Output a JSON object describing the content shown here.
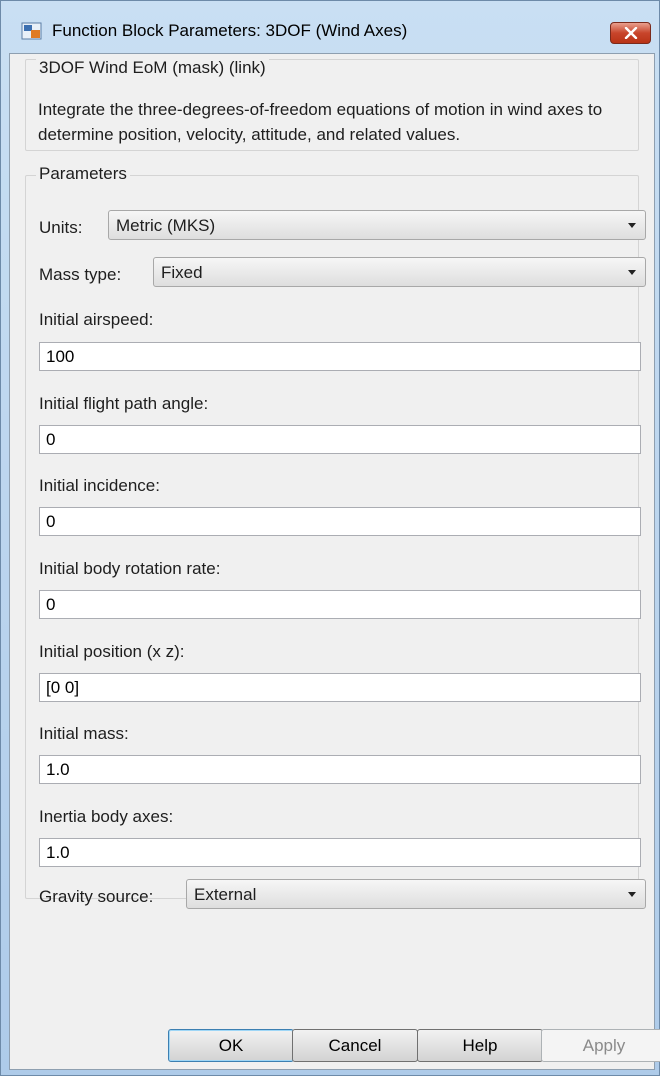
{
  "window": {
    "title": "Function Block Parameters: 3DOF (Wind Axes)"
  },
  "header": {
    "legend": "3DOF Wind EoM (mask) (link)",
    "description": "Integrate the three-degrees-of-freedom equations of motion in wind axes to determine position, velocity, attitude, and related values."
  },
  "params": {
    "legend": "Parameters",
    "units_label": "Units:",
    "units_value": "Metric (MKS)",
    "mass_type_label": "Mass type:",
    "mass_type_value": "Fixed",
    "airspeed_label": "Initial airspeed:",
    "airspeed_value": "100",
    "fpa_label": "Initial flight path angle:",
    "fpa_value": "0",
    "incidence_label": "Initial incidence:",
    "incidence_value": "0",
    "rotation_label": "Initial body rotation rate:",
    "rotation_value": "0",
    "position_label": "Initial position (x z):",
    "position_value": "[0 0]",
    "mass_label": "Initial mass:",
    "mass_value": "1.0",
    "inertia_label": "Inertia body axes:",
    "inertia_value": "1.0",
    "gravity_label": "Gravity source:",
    "gravity_value": "External"
  },
  "buttons": {
    "ok": "OK",
    "cancel": "Cancel",
    "help": "Help",
    "apply": "Apply"
  },
  "icons": {
    "app": "simulink-block-icon",
    "close": "close-icon",
    "dropdown": "chevron-down-icon"
  },
  "colors": {
    "close_button": "#c8452b",
    "title_bar": "#b9d4ee",
    "dialog_bg": "#f0f0f0"
  }
}
